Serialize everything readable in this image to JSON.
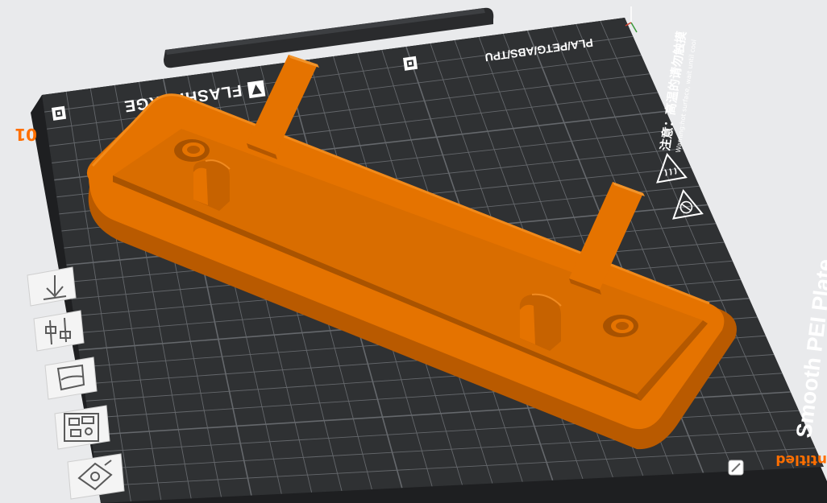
{
  "app": {
    "plate_index": "01",
    "plate_name_partial": "ntitled",
    "theme": {
      "accent": "#ff6f00",
      "model_color": "#e57300",
      "model_shadow": "#b85a00",
      "bed_color": "#2f3133",
      "bed_edge": "#1e1f21",
      "grid_color": "#6f7276",
      "background": "#e9eaec"
    }
  },
  "bed": {
    "brand": "FLASHFORGE",
    "materials": "PLA/PETG/ABS/TPU",
    "plate_label": "Smooth PEI Plate",
    "warning_cn": "注意：高温的请勿触摸",
    "warning_en": "Warning:hot surface, wait until cool"
  },
  "toolbar": {
    "items": [
      {
        "name": "arrange-tool",
        "icon": "arrow-down-icon"
      },
      {
        "name": "place-on-face-tool",
        "icon": "sliders-icon"
      },
      {
        "name": "support-paint-tool",
        "icon": "cup-icon"
      },
      {
        "name": "layout-tool",
        "icon": "grid-icon"
      },
      {
        "name": "view-tool",
        "icon": "eye-icon"
      }
    ]
  }
}
